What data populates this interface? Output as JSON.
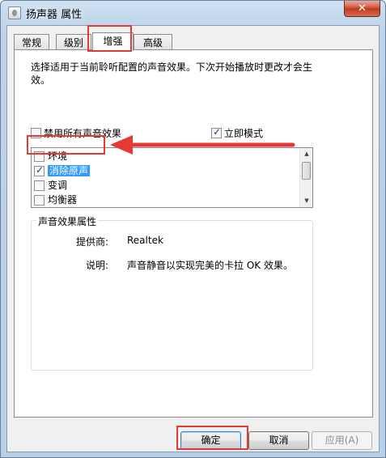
{
  "window": {
    "title": "扬声器 属性",
    "close_label": "✕"
  },
  "tabs": [
    {
      "label": "常规"
    },
    {
      "label": "级别"
    },
    {
      "label": "增强"
    },
    {
      "label": "高级"
    }
  ],
  "enhance": {
    "description": "选择适用于当前聆听配置的声音效果。下次开始播放时更改才会生效。",
    "disable_all_label": "禁用所有声音效果",
    "disable_all_checked": false,
    "immediate_mode_label": "立即模式",
    "immediate_mode_checked": true,
    "effects": [
      {
        "label": "环境",
        "checked": false
      },
      {
        "label": "消除原声",
        "checked": true,
        "selected": true
      },
      {
        "label": "变调",
        "checked": false
      },
      {
        "label": "均衡器",
        "checked": false
      }
    ],
    "properties_title": "声音效果属性",
    "provider_label": "提供商:",
    "provider_value": "Realtek",
    "explanation_label": "说明:",
    "explanation_value": "声音静音以实现完美的卡拉 OK 效果。"
  },
  "buttons": {
    "ok": "确定",
    "cancel": "取消",
    "apply": "应用(A)"
  },
  "colors": {
    "annotation_red": "#e53935",
    "selection_blue": "#3399ff"
  }
}
